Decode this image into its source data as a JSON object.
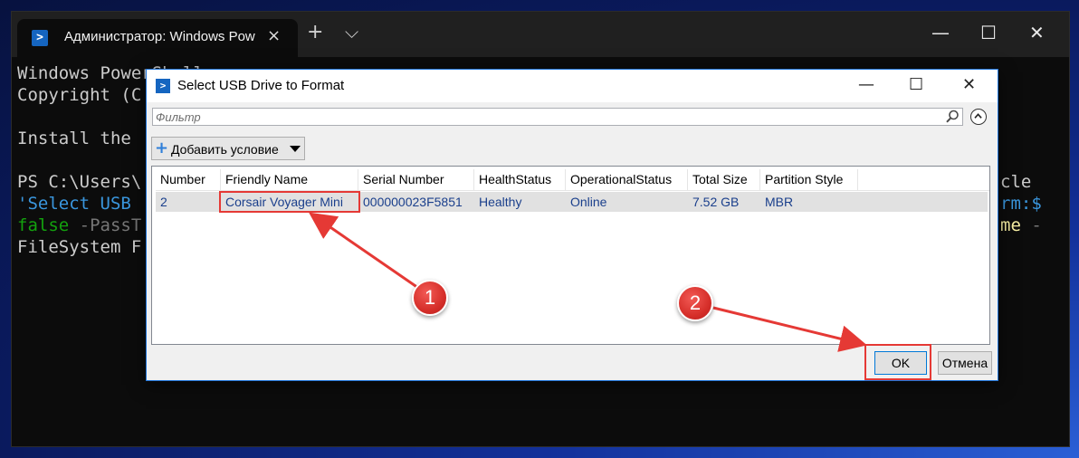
{
  "terminal": {
    "tab_title": "Администратор: Windows Pow",
    "tab_close": "×",
    "new_tab": "+",
    "dropdown": "⌵",
    "minimize": "—",
    "maximize": "☐",
    "close": "✕",
    "lines": {
      "l1": "Windows PowerShell",
      "l2": "Copyright (C",
      "l3": "Install the",
      "l4_prompt": "PS C:\\Users\\",
      "l5_cmd": "'Select USB",
      "l6_false": "false",
      "l6_rest": " -PassT",
      "l7": "FileSystem F",
      "r1": "cle",
      "r2": "rm:$",
      "r3_me": "me",
      "r3_dash": " -"
    }
  },
  "dialog": {
    "title": "Select USB Drive to Format",
    "minimize": "—",
    "maximize": "☐",
    "close": "✕",
    "filter_placeholder": "Фильтр",
    "add_condition_label": "Добавить условие",
    "add_condition_plus": "+",
    "columns": [
      "Number",
      "Friendly Name",
      "Serial Number",
      "HealthStatus",
      "OperationalStatus",
      "Total Size",
      "Partition Style"
    ],
    "rows": [
      {
        "number": "2",
        "friendly_name": "Corsair Voyager Mini",
        "serial_number": "000000023F5851",
        "health_status": "Healthy",
        "operational_status": "Online",
        "total_size": "7.52 GB",
        "partition_style": "MBR"
      }
    ],
    "ok_label": "OK",
    "cancel_label": "Отмена"
  },
  "annotations": {
    "badge1": "1",
    "badge2": "2",
    "color": "#e53935"
  }
}
